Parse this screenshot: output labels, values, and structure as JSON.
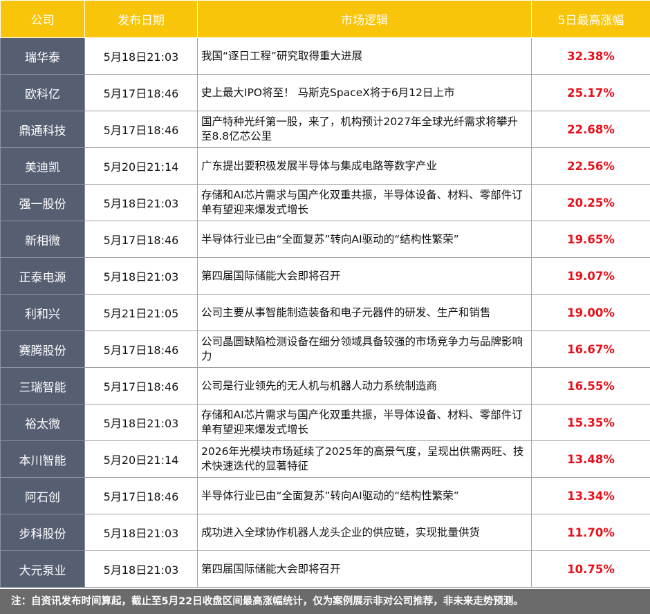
{
  "header": {
    "company": "公司",
    "date": "发布日期",
    "logic": "市场逻辑",
    "gain": "5日最高涨幅"
  },
  "rows": [
    {
      "company": "瑞华泰",
      "date": "5月18日21:03",
      "logic": "我国“逐日工程”研究取得重大进展",
      "gain": "32.38%"
    },
    {
      "company": "欧科亿",
      "date": "5月17日18:46",
      "logic": "史上最大IPO将至！ 马斯克SpaceX将于6月12日上市",
      "gain": "25.17%"
    },
    {
      "company": "鼎通科技",
      "date": "5月17日18:46",
      "logic": "国产特种光纤第一股，来了，机构预计2027年全球光纤需求将攀升至8.8亿芯公里",
      "gain": "22.68%"
    },
    {
      "company": "美迪凯",
      "date": "5月20日21:14",
      "logic": "广东提出要积极发展半导体与集成电路等数字产业",
      "gain": "22.56%"
    },
    {
      "company": "强一股份",
      "date": "5月18日21:03",
      "logic": "存储和AI芯片需求与国产化双重共振，半导体设备、材料、零部件订单有望迎来爆发式增长",
      "gain": "20.25%"
    },
    {
      "company": "新相微",
      "date": "5月17日18:46",
      "logic": "半导体行业已由“全面复苏”转向AI驱动的“结构性繁荣”",
      "gain": "19.65%"
    },
    {
      "company": "正泰电源",
      "date": "5月18日21:03",
      "logic": "第四届国际储能大会即将召开",
      "gain": "19.07%"
    },
    {
      "company": "利和兴",
      "date": "5月21日21:05",
      "logic": "公司主要从事智能制造装备和电子元器件的研发、生产和销售",
      "gain": "19.00%"
    },
    {
      "company": "赛腾股份",
      "date": "5月17日18:46",
      "logic": "公司晶圆缺陷检测设备在细分领域具备较强的市场竞争力与品牌影响力",
      "gain": "16.67%"
    },
    {
      "company": "三瑞智能",
      "date": "5月17日18:46",
      "logic": "公司是行业领先的无人机与机器人动力系统制造商",
      "gain": "16.55%"
    },
    {
      "company": "裕太微",
      "date": "5月18日21:03",
      "logic": "存储和AI芯片需求与国产化双重共振，半导体设备、材料、零部件订单有望迎来爆发式增长",
      "gain": "15.35%"
    },
    {
      "company": "本川智能",
      "date": "5月20日21:14",
      "logic": "2026年光模块市场延续了2025年的高景气度，呈现出供需两旺、技术快速迭代的显著特征",
      "gain": "13.48%"
    },
    {
      "company": "阿石创",
      "date": "5月17日18:46",
      "logic": "半导体行业已由“全面复苏”转向AI驱动的“结构性繁荣”",
      "gain": "13.34%"
    },
    {
      "company": "步科股份",
      "date": "5月18日21:03",
      "logic": "成功进入全球协作机器人龙头企业的供应链，实现批量供货",
      "gain": "11.70%"
    },
    {
      "company": "大元泵业",
      "date": "5月18日21:03",
      "logic": "第四届国际储能大会即将召开",
      "gain": "10.75%"
    }
  ],
  "footer": "注：自资讯发布时间算起，截止至5月22日收盘区间最高涨幅统计，仅为案例展示非对公司推荐，非未来走势预测。",
  "colors": {
    "header_bg": "#f8c50a",
    "company_bg": "#565e72",
    "gain_text": "#e8101a",
    "footer_bg": "#6b6b6b"
  }
}
